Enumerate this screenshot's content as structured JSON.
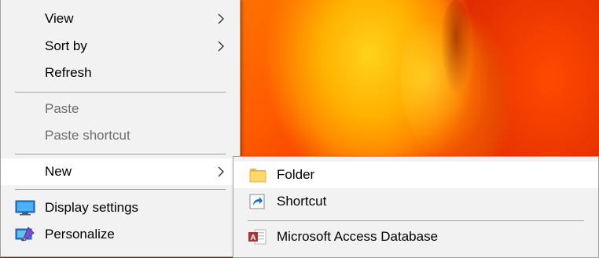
{
  "context_menu": {
    "items": [
      {
        "label": "View",
        "has_submenu": true
      },
      {
        "label": "Sort by",
        "has_submenu": true
      },
      {
        "label": "Refresh"
      },
      {
        "label": "Paste",
        "disabled": true
      },
      {
        "label": "Paste shortcut",
        "disabled": true
      },
      {
        "label": "New",
        "has_submenu": true,
        "highlighted": true
      },
      {
        "label": "Display settings",
        "icon": "display-settings-icon"
      },
      {
        "label": "Personalize",
        "icon": "personalize-icon"
      }
    ]
  },
  "new_submenu": {
    "items": [
      {
        "label": "Folder",
        "icon": "folder-icon",
        "highlighted": true
      },
      {
        "label": "Shortcut",
        "icon": "shortcut-icon"
      },
      {
        "label": "Microsoft Access Database",
        "icon": "access-database-icon"
      }
    ]
  },
  "colors": {
    "menu_bg": "#f2f2f2",
    "hover_bg": "#ffffff",
    "disabled_text": "#6d6d6d",
    "separator": "#a0a0a0"
  }
}
